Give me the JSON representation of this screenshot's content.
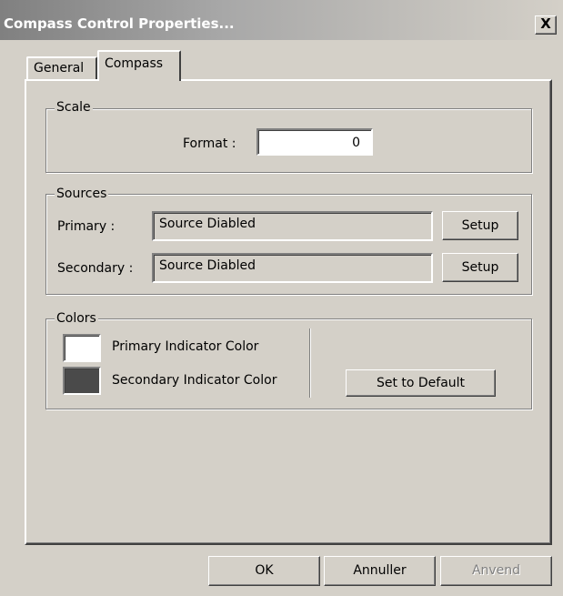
{
  "window": {
    "title": "Compass Control Properties...",
    "close_label": "X"
  },
  "tabs": [
    {
      "label": "General",
      "selected": false
    },
    {
      "label": "Compass",
      "selected": true
    }
  ],
  "scale": {
    "legend": "Scale",
    "format_label": "Format :",
    "format_value": "0"
  },
  "sources": {
    "legend": "Sources",
    "primary_label": "Primary :",
    "primary_value": "Source Diabled",
    "secondary_label": "Secondary :",
    "secondary_value": "Source Diabled",
    "setup_label": "Setup"
  },
  "colors": {
    "legend": "Colors",
    "primary_label": "Primary Indicator Color",
    "primary_color": "#ffffff",
    "secondary_label": "Secondary Indicator Color",
    "secondary_color": "#4a4a4a",
    "default_button": "Set to Default"
  },
  "buttons": {
    "ok": "OK",
    "cancel": "Annuller",
    "apply": "Anvend",
    "apply_enabled": false
  }
}
